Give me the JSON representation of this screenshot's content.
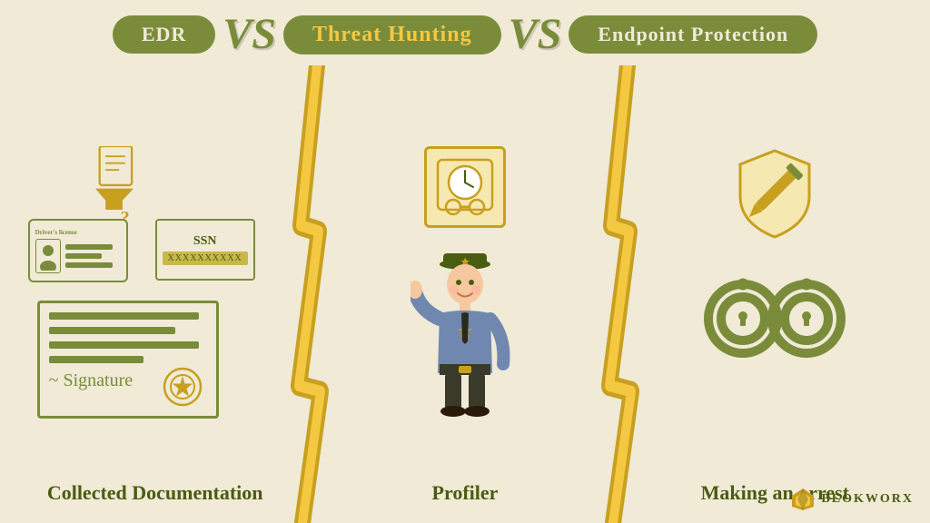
{
  "header": {
    "edr_label": "EDR",
    "vs1_label": "VS",
    "threat_label": "Threat Hunting",
    "vs2_label": "VS",
    "endpoint_label": "Endpoint Protection"
  },
  "sections": {
    "edr": {
      "caption": "Collected Documentation",
      "license_title": "Driver's license",
      "ssn_title": "SSN",
      "ssn_number": "XXXXXXXXXX"
    },
    "threat": {
      "caption": "Profiler"
    },
    "endpoint": {
      "caption": "Making an arrest"
    }
  },
  "brand": {
    "name": "BLOKWORX"
  },
  "colors": {
    "background": "#f0ead6",
    "olive": "#7a8c3a",
    "dark_olive": "#4a5c10",
    "gold": "#c8a020",
    "yellow": "#f5c842"
  }
}
